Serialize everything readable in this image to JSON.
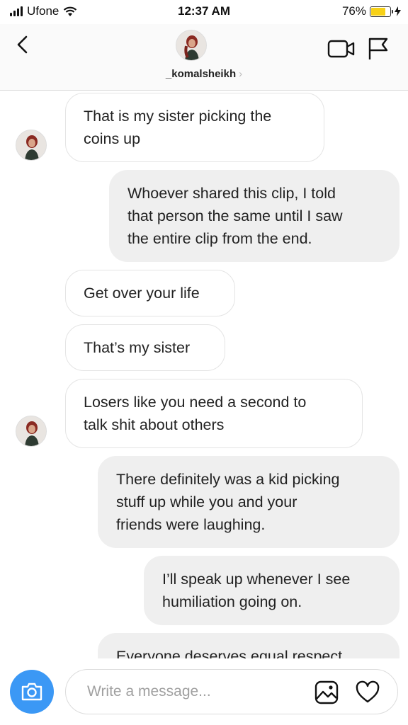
{
  "status_bar": {
    "carrier": "Ufone",
    "time": "12:37 AM",
    "battery_percent": "76%",
    "battery_level": 0.76,
    "battery_color": "#f7d117"
  },
  "header": {
    "back_icon": "chevron-left-icon",
    "username": "_komalsheikh",
    "username_chevron": "›",
    "video_icon": "video-camera-icon",
    "flag_icon": "flag-icon"
  },
  "messages": [
    {
      "direction": "incoming",
      "lines": [
        "That is my sister picking the",
        "coins up"
      ]
    },
    {
      "direction": "outgoing",
      "lines": [
        "Whoever shared this clip, I told",
        "that person the same until I saw",
        "the entire clip from the end."
      ]
    },
    {
      "direction": "incoming",
      "lines": [
        "Get over your life"
      ]
    },
    {
      "direction": "incoming",
      "lines": [
        "That’s my sister"
      ]
    },
    {
      "direction": "incoming",
      "lines": [
        "Losers like you need a second to",
        "talk shit about others"
      ]
    },
    {
      "direction": "outgoing",
      "lines": [
        "There definitely was a kid picking",
        "stuff up while you and your",
        "friends were laughing."
      ]
    },
    {
      "direction": "outgoing",
      "lines": [
        "I’ll speak up whenever I see",
        "humiliation going on."
      ]
    },
    {
      "direction": "outgoing",
      "lines": [
        "Everyone deserves equal respect"
      ]
    }
  ],
  "composer": {
    "placeholder": "Write a message...",
    "value": "",
    "camera_icon": "camera-icon",
    "gallery_icon": "gallery-icon",
    "heart_icon": "heart-icon",
    "accent_color": "#3b98f5"
  }
}
